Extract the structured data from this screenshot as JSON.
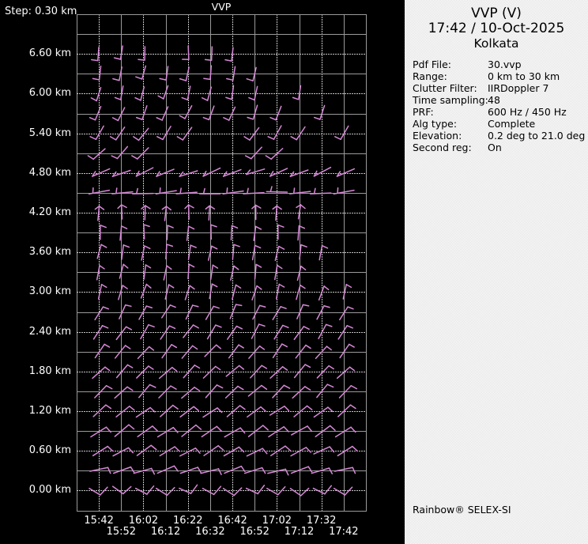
{
  "plot": {
    "title": "VVP",
    "step_label": "Step: 0.30 km",
    "y_labels": [
      "6.60 km",
      "6.00 km",
      "5.40 km",
      "4.80 km",
      "4.20 km",
      "3.60 km",
      "3.00 km",
      "2.40 km",
      "1.80 km",
      "1.20 km",
      "0.60 km",
      "0.00 km"
    ],
    "x_labels_row1": [
      "15:42",
      "16:02",
      "16:22",
      "16:42",
      "17:02",
      "17:32"
    ],
    "x_labels_row2": [
      "15:52",
      "16:12",
      "16:32",
      "16:52",
      "17:12",
      "17:42"
    ],
    "colors": {
      "background": "#000000",
      "grid_solid": "#9a9a9a",
      "grid_dotted": "#e0e0e0",
      "barb": "#d689d6",
      "text": "#ffffff"
    }
  },
  "chart_data": {
    "type": "wind-barb-time-height",
    "title": "VVP",
    "x_times": [
      "15:42",
      "15:52",
      "16:02",
      "16:12",
      "16:22",
      "16:32",
      "16:42",
      "16:52",
      "17:02",
      "17:12",
      "17:32",
      "17:42"
    ],
    "altitude_step_km": 0.3,
    "altitudes_km": [
      6.6,
      6.3,
      6.0,
      5.7,
      5.4,
      5.1,
      4.8,
      4.5,
      4.2,
      3.9,
      3.6,
      3.3,
      3.0,
      2.7,
      2.4,
      2.1,
      1.8,
      1.5,
      1.2,
      0.9,
      0.6,
      0.3,
      0.0
    ],
    "ylim_km": [
      0.0,
      7.2
    ],
    "grid": "on",
    "rows": [
      {
        "alt_km": 6.6,
        "present": [
          1,
          1,
          1,
          0,
          1,
          1,
          1,
          0,
          0,
          0,
          0,
          0
        ],
        "glyph": [
          [
            1,
            -9,
            0,
            8
          ],
          [
            0,
            8,
            -8,
            7
          ]
        ]
      },
      {
        "alt_km": 6.3,
        "present": [
          1,
          1,
          1,
          1,
          1,
          1,
          1,
          1,
          0,
          0,
          0,
          0
        ],
        "glyph": [
          [
            2,
            -9,
            -1,
            8
          ],
          [
            -1,
            8,
            -9,
            6
          ]
        ]
      },
      {
        "alt_km": 6.0,
        "present": [
          1,
          1,
          1,
          1,
          1,
          1,
          1,
          1,
          0,
          1,
          0,
          0
        ],
        "glyph": [
          [
            2,
            -9,
            -2,
            8
          ],
          [
            -2,
            8,
            -9,
            5
          ]
        ]
      },
      {
        "alt_km": 5.7,
        "present": [
          1,
          1,
          1,
          1,
          1,
          1,
          1,
          1,
          1,
          0,
          1,
          0
        ],
        "glyph": [
          [
            4,
            -9,
            -3,
            8
          ],
          [
            -3,
            8,
            -10,
            5
          ]
        ]
      },
      {
        "alt_km": 5.4,
        "present": [
          1,
          1,
          1,
          1,
          1,
          0,
          0,
          1,
          1,
          1,
          0,
          1
        ],
        "glyph": [
          [
            6,
            -8,
            -5,
            8
          ],
          [
            -5,
            8,
            -12,
            4
          ]
        ]
      },
      {
        "alt_km": 5.1,
        "present": [
          1,
          1,
          1,
          0,
          0,
          0,
          0,
          1,
          1,
          0,
          0,
          0
        ],
        "glyph": [
          [
            8,
            -7,
            -6,
            7
          ],
          [
            -6,
            7,
            -13,
            3
          ]
        ]
      },
      {
        "alt_km": 4.8,
        "present": [
          1,
          1,
          1,
          1,
          1,
          1,
          1,
          1,
          1,
          1,
          1,
          1
        ],
        "glyph": [
          [
            12,
            -5,
            -10,
            4
          ],
          [
            -10,
            4,
            -6,
            -2
          ]
        ]
      },
      {
        "alt_km": 4.5,
        "present": [
          1,
          1,
          1,
          1,
          1,
          1,
          1,
          1,
          1,
          1,
          1,
          1
        ],
        "glyph": [
          [
            13,
            -1,
            -13,
            1
          ],
          [
            -8,
            0,
            -7,
            -6
          ]
        ]
      },
      {
        "alt_km": 4.2,
        "present": [
          1,
          1,
          1,
          1,
          1,
          1,
          0,
          1,
          1,
          1,
          0,
          0
        ],
        "glyph": [
          [
            1,
            -9,
            0,
            9
          ],
          [
            1,
            -9,
            7,
            -5
          ],
          [
            1,
            -9,
            -4,
            -5
          ]
        ]
      },
      {
        "alt_km": 3.9,
        "present": [
          1,
          1,
          1,
          1,
          1,
          1,
          1,
          1,
          1,
          1,
          0,
          0
        ],
        "glyph": [
          [
            1,
            -9,
            0,
            9
          ],
          [
            1,
            -9,
            8,
            -6
          ]
        ]
      },
      {
        "alt_km": 3.6,
        "present": [
          1,
          1,
          1,
          1,
          1,
          1,
          1,
          1,
          1,
          1,
          1,
          0
        ],
        "glyph": [
          [
            2,
            -9,
            -1,
            9
          ],
          [
            2,
            -9,
            9,
            -6
          ]
        ]
      },
      {
        "alt_km": 3.3,
        "present": [
          1,
          1,
          1,
          1,
          1,
          1,
          1,
          1,
          1,
          1,
          0,
          0
        ],
        "glyph": [
          [
            2,
            -9,
            -1,
            9
          ],
          [
            2,
            -9,
            8,
            -5
          ]
        ]
      },
      {
        "alt_km": 3.0,
        "present": [
          1,
          1,
          1,
          1,
          1,
          1,
          1,
          1,
          1,
          1,
          1,
          1
        ],
        "glyph": [
          [
            3,
            -9,
            -2,
            9
          ],
          [
            3,
            -9,
            9,
            -5
          ]
        ]
      },
      {
        "alt_km": 2.7,
        "present": [
          1,
          1,
          1,
          1,
          1,
          1,
          1,
          1,
          1,
          1,
          1,
          1
        ],
        "glyph": [
          [
            5,
            -8,
            -4,
            9
          ],
          [
            5,
            -8,
            12,
            -6
          ]
        ]
      },
      {
        "alt_km": 2.4,
        "present": [
          1,
          1,
          1,
          1,
          1,
          1,
          1,
          1,
          1,
          1,
          1,
          1
        ],
        "glyph": [
          [
            6,
            -8,
            -5,
            9
          ],
          [
            6,
            -8,
            13,
            -5
          ]
        ]
      },
      {
        "alt_km": 2.1,
        "present": [
          1,
          1,
          1,
          1,
          1,
          1,
          1,
          1,
          1,
          1,
          1,
          1
        ],
        "glyph": [
          [
            7,
            -8,
            -6,
            8
          ],
          [
            7,
            -8,
            13,
            -4
          ]
        ]
      },
      {
        "alt_km": 1.8,
        "present": [
          1,
          1,
          1,
          1,
          1,
          1,
          1,
          1,
          1,
          1,
          1,
          1
        ],
        "glyph": [
          [
            8,
            -7,
            -7,
            8
          ],
          [
            8,
            -7,
            14,
            -3
          ]
        ]
      },
      {
        "alt_km": 1.5,
        "present": [
          1,
          1,
          1,
          1,
          1,
          1,
          1,
          1,
          1,
          1,
          1,
          1
        ],
        "glyph": [
          [
            8,
            -7,
            -7,
            8
          ],
          [
            8,
            -7,
            15,
            -3
          ]
        ]
      },
      {
        "alt_km": 1.2,
        "present": [
          1,
          1,
          1,
          1,
          1,
          1,
          1,
          1,
          1,
          1,
          1,
          1
        ],
        "glyph": [
          [
            9,
            -6,
            -8,
            7
          ],
          [
            9,
            -6,
            15,
            -1
          ]
        ]
      },
      {
        "alt_km": 0.9,
        "present": [
          1,
          1,
          1,
          1,
          1,
          1,
          1,
          1,
          1,
          1,
          1,
          1
        ],
        "glyph": [
          [
            10,
            -6,
            -9,
            7
          ],
          [
            10,
            -6,
            16,
            0
          ]
        ]
      },
      {
        "alt_km": 0.6,
        "present": [
          1,
          1,
          1,
          1,
          1,
          1,
          1,
          1,
          1,
          1,
          1,
          1
        ],
        "glyph": [
          [
            10,
            -5,
            -9,
            6
          ],
          [
            10,
            -5,
            16,
            1
          ]
        ]
      },
      {
        "alt_km": 0.3,
        "present": [
          1,
          1,
          1,
          1,
          1,
          1,
          1,
          1,
          1,
          1,
          1,
          1
        ],
        "glyph": [
          [
            11,
            -4,
            -11,
            3
          ],
          [
            11,
            -4,
            15,
            3
          ]
        ]
      },
      {
        "alt_km": 0.0,
        "present": [
          1,
          1,
          1,
          1,
          1,
          1,
          1,
          1,
          1,
          1,
          1,
          1
        ],
        "glyph": [
          [
            3,
            5,
            -11,
            -3
          ],
          [
            3,
            5,
            12,
            -5
          ]
        ]
      }
    ]
  },
  "panel": {
    "title": "VVP (V)",
    "datetime": "17:42 / 10-Oct-2025",
    "site": "Kolkata",
    "fields": [
      {
        "label": "Pdf File:",
        "value": "30.vvp"
      },
      {
        "label": "Range:",
        "value": "0 km to 30 km"
      },
      {
        "label": "Clutter Filter:",
        "value": "IIRDoppler 7"
      },
      {
        "label": "Time sampling:",
        "value": "48"
      },
      {
        "label": "PRF:",
        "value": "600 Hz / 450 Hz"
      },
      {
        "label": "Alg type:",
        "value": "Complete"
      },
      {
        "label": "Elevation:",
        "value": "0.2 deg to 21.0 deg"
      },
      {
        "label": "Second reg:",
        "value": "On"
      }
    ],
    "footer": "Rainbow® SELEX-SI"
  }
}
